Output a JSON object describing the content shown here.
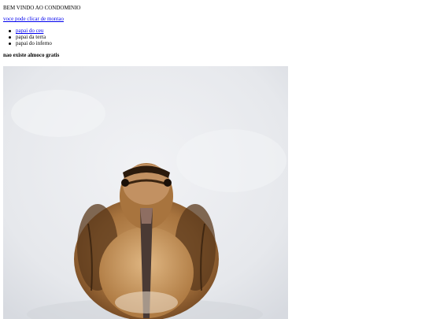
{
  "welcome_text": "BEM VINDO AO CONDOMINIO",
  "montao_link": "voce pode clicar de montao",
  "papai_items": [
    {
      "label": "papai do ceu",
      "is_link": true
    },
    {
      "label": "papai da terra",
      "is_link": false
    },
    {
      "label": "papai do inferno",
      "is_link": false
    }
  ],
  "almoco_heading": "nao existe almoco gratis",
  "photo": {
    "subject": "woodcock bird in snow"
  },
  "colors": {
    "link": "#0000ee",
    "text": "#000000",
    "background": "#ffffff"
  }
}
